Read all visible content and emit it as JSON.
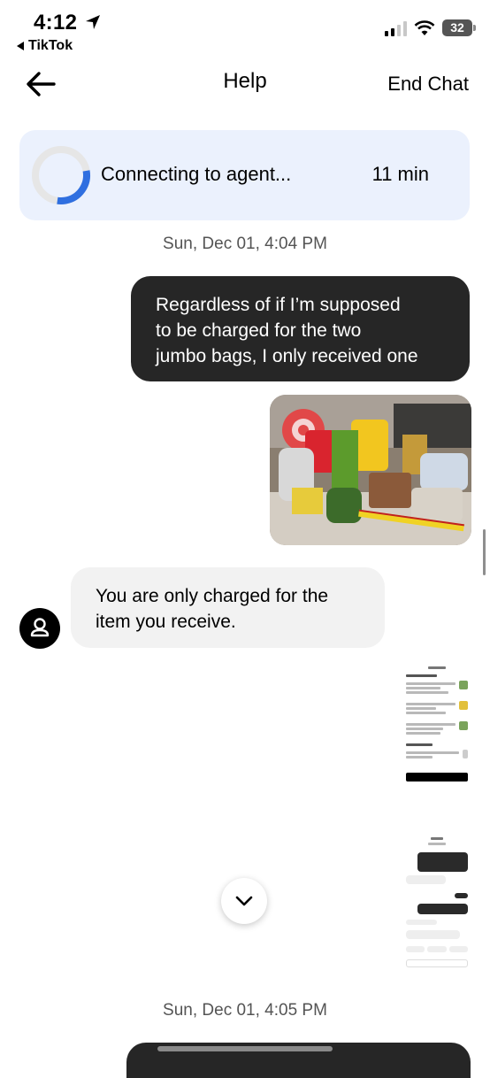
{
  "status_bar": {
    "time": "4:12",
    "back_app": "TikTok",
    "battery": "32"
  },
  "header": {
    "title": "Help",
    "end_chat": "End Chat"
  },
  "agent_status": {
    "label": "Connecting to agent...",
    "wait_time": "11 min",
    "progress": 0.3
  },
  "messages": {
    "timestamp_1": "Sun, Dec 01, 4:04 PM",
    "outgoing_1_lines": [
      "Regardless of if I’m supposed",
      "to be charged for the two",
      "jumbo bags, I only received one"
    ],
    "incoming_1_lines": [
      "You are only charged for the",
      "item you receive."
    ],
    "timestamp_2": "Sun, Dec 01, 4:05 PM"
  },
  "colors": {
    "agent_card_bg": "#ebf1fd",
    "ring_progress": "#2f6fe0",
    "outgoing_bubble": "#262626",
    "incoming_bubble": "#f2f2f2"
  }
}
